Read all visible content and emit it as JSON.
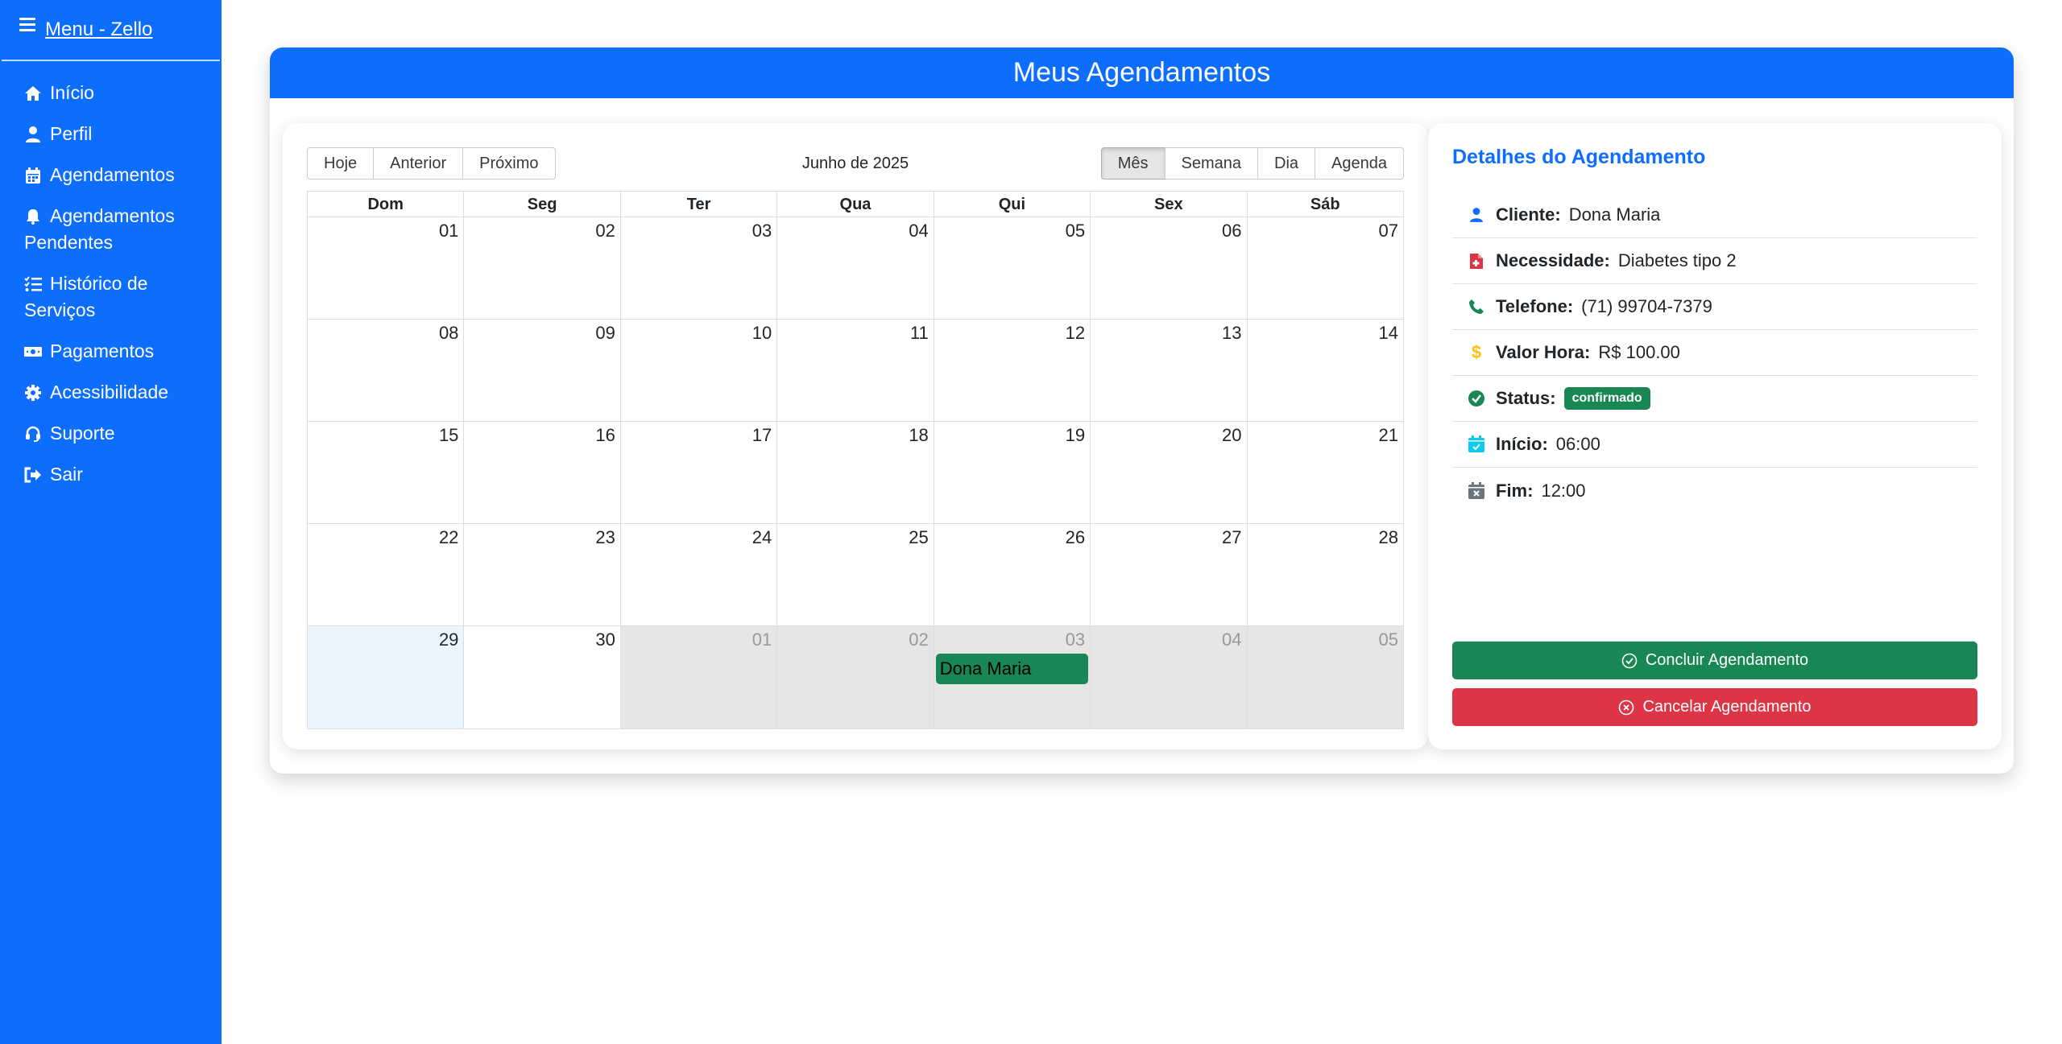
{
  "sidebar": {
    "title": "Menu - Zello",
    "items": [
      {
        "label": "Início",
        "icon": "home-icon"
      },
      {
        "label": "Perfil",
        "icon": "user-icon"
      },
      {
        "label": "Agendamentos",
        "icon": "calendar-icon"
      },
      {
        "label": "Agendamentos Pendentes",
        "icon": "bell-icon"
      },
      {
        "label": "Histórico de Serviços",
        "icon": "list-check-icon"
      },
      {
        "label": "Pagamentos",
        "icon": "money-icon"
      },
      {
        "label": "Acessibilidade",
        "icon": "gear-icon"
      },
      {
        "label": "Suporte",
        "icon": "headset-icon"
      },
      {
        "label": "Sair",
        "icon": "logout-icon"
      }
    ]
  },
  "page": {
    "title": "Meus Agendamentos"
  },
  "calendar": {
    "nav_buttons": [
      "Hoje",
      "Anterior",
      "Próximo"
    ],
    "label": "Junho de 2025",
    "view_buttons": [
      "Mês",
      "Semana",
      "Dia",
      "Agenda"
    ],
    "active_view": "Mês",
    "weekdays": [
      "Dom",
      "Seg",
      "Ter",
      "Qua",
      "Qui",
      "Sex",
      "Sáb"
    ],
    "weeks": [
      [
        "01",
        "02",
        "03",
        "04",
        "05",
        "06",
        "07"
      ],
      [
        "08",
        "09",
        "10",
        "11",
        "12",
        "13",
        "14"
      ],
      [
        "15",
        "16",
        "17",
        "18",
        "19",
        "20",
        "21"
      ],
      [
        "22",
        "23",
        "24",
        "25",
        "26",
        "27",
        "28"
      ],
      [
        "29",
        "30",
        "01",
        "02",
        "03",
        "04",
        "05"
      ]
    ],
    "event": {
      "title": "Dona Maria",
      "color": "#198754"
    }
  },
  "details": {
    "title": "Detalhes do Agendamento",
    "cliente_label": "Cliente:",
    "cliente": "Dona Maria",
    "necessidade_label": "Necessidade:",
    "necessidade": "Diabetes tipo 2",
    "telefone_label": "Telefone:",
    "telefone": "(71) 99704-7379",
    "valor_label": "Valor Hora:",
    "valor": "R$ 100.00",
    "status_label": "Status:",
    "status": "confirmado",
    "inicio_label": "Início:",
    "inicio": "06:00",
    "fim_label": "Fim:",
    "fim": "12:00",
    "concluir": "Concluir Agendamento",
    "cancelar": "Cancelar Agendamento"
  },
  "colors": {
    "primary": "#0d6efd",
    "success": "#198754",
    "danger": "#dc3545"
  }
}
